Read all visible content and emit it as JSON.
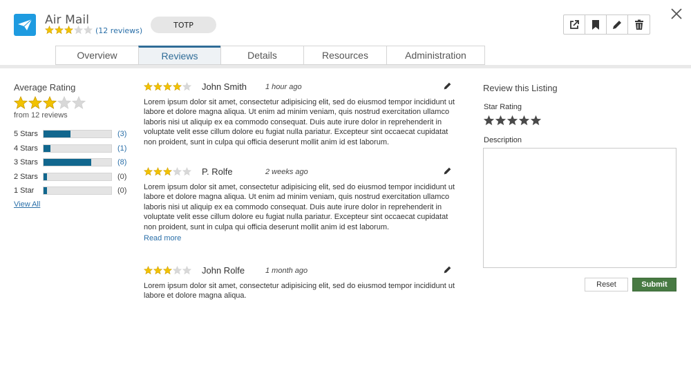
{
  "colors": {
    "brand": "#1e9be0",
    "accent": "#2f6c97",
    "bar": "#11678e",
    "link": "#2a6fa8",
    "submit": "#487a43",
    "star_filled": "#f2c200",
    "star_empty": "#d8d8d8"
  },
  "app": {
    "icon": "paper-plane-icon",
    "title": "Air Mail",
    "rating": 3,
    "rating_max": 5,
    "reviews_link": "(12 reviews)",
    "tag": "TOTP"
  },
  "toolbar": {
    "buttons": [
      {
        "icon": "external-link-icon"
      },
      {
        "icon": "bookmark-icon"
      },
      {
        "icon": "pencil-icon"
      },
      {
        "icon": "trash-icon"
      }
    ],
    "close_icon": "close-icon"
  },
  "tabs": [
    {
      "label": "Overview",
      "active": false
    },
    {
      "label": "Reviews",
      "active": true
    },
    {
      "label": "Details",
      "active": false
    },
    {
      "label": "Resources",
      "active": false
    },
    {
      "label": "Administration",
      "active": false
    }
  ],
  "average": {
    "title": "Average Rating",
    "rating": 3,
    "from": "from 12 reviews",
    "rows": [
      {
        "label": "5 Stars",
        "count": "(3)",
        "fraction": 0.4
      },
      {
        "label": "4 Stars",
        "count": "(1)",
        "fraction": 0.1
      },
      {
        "label": "3 Stars",
        "count": "(8)",
        "fraction": 0.7
      },
      {
        "label": "2 Stars",
        "count": "(0)",
        "fraction": 0.05
      },
      {
        "label": "1 Star",
        "count": "(0)",
        "fraction": 0.05
      }
    ],
    "view_all": "View All"
  },
  "reviews": [
    {
      "rating": 4,
      "name": "John Smith",
      "time": "1 hour ago",
      "body": "Lorem ipsum dolor sit amet, consectetur adipisicing elit, sed do eiusmod tempor incididunt ut labore et dolore magna aliqua. Ut enim ad minim veniam, quis nostrud exercitation ullamco laboris nisi ut aliquip ex ea commodo consequat. Duis aute irure dolor in reprehenderit in voluptate velit esse cillum dolore eu fugiat nulla pariatur. Excepteur sint occaecat cupidatat non proident, sunt in culpa qui officia deserunt mollit anim id est laborum.",
      "read_more": ""
    },
    {
      "rating": 3,
      "name": "P. Rolfe",
      "time": "2 weeks ago",
      "body": "Lorem ipsum dolor sit amet, consectetur adipisicing elit, sed do eiusmod tempor incididunt ut labore et dolore magna aliqua. Ut enim ad minim veniam, quis nostrud exercitation ullamco laboris nisi ut aliquip ex ea commodo consequat. Duis aute irure dolor in reprehenderit in voluptate velit esse cillum dolore eu fugiat nulla pariatur. Excepteur sint occaecat cupidatat non proident, sunt in culpa qui officia deserunt mollit anim id est laborum.",
      "read_more": "Read more"
    },
    {
      "rating": 3,
      "name": "John Rolfe",
      "time": "1 month ago",
      "body": "Lorem ipsum dolor sit amet, consectetur adipisicing elit, sed do eiusmod tempor incididunt ut labore et dolore magna aliqua.",
      "read_more": ""
    }
  ],
  "review_form": {
    "title": "Review this Listing",
    "star_label": "Star Rating",
    "star_value": 0,
    "desc_label": "Description",
    "desc_value": "",
    "reset_label": "Reset",
    "submit_label": "Submit"
  }
}
